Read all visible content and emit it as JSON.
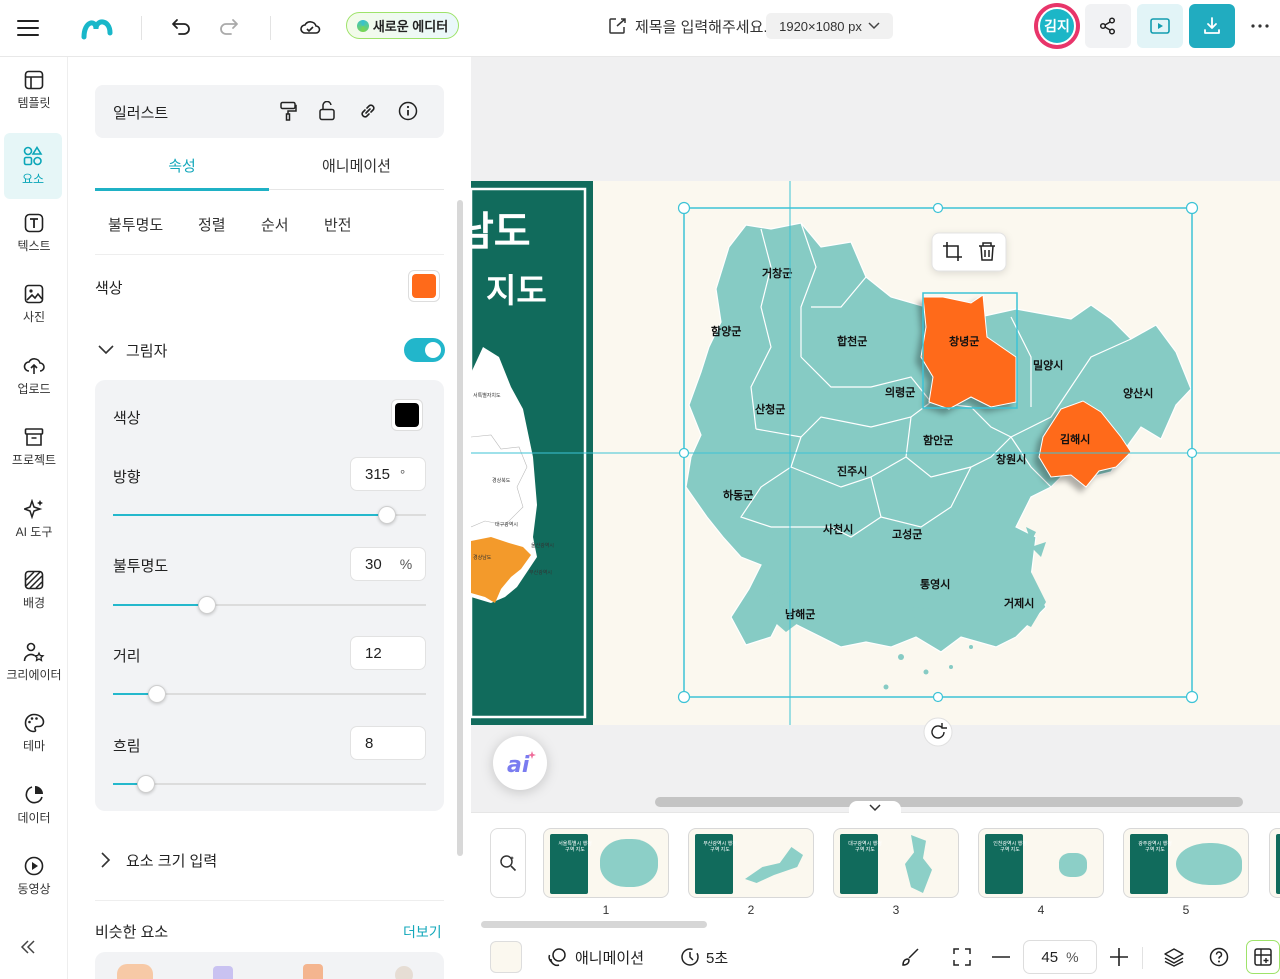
{
  "header": {
    "new_editor_label": "새로운 에디터",
    "doc_title_placeholder": "제목을 입력해주세요.",
    "size_label": "1920×1080 px",
    "avatar_name": "김지"
  },
  "rail": [
    {
      "label": "템플릿"
    },
    {
      "label": "요소"
    },
    {
      "label": "텍스트"
    },
    {
      "label": "사진"
    },
    {
      "label": "업로드"
    },
    {
      "label": "프로젝트"
    },
    {
      "label": "AI 도구"
    },
    {
      "label": "배경"
    },
    {
      "label": "크리에이터"
    },
    {
      "label": "테마"
    },
    {
      "label": "데이터"
    },
    {
      "label": "동영상"
    }
  ],
  "panel": {
    "element_type": "일러스트",
    "tabs": {
      "properties": "속성",
      "animation": "애니메이션"
    },
    "subtabs": [
      "불투명도",
      "정렬",
      "순서",
      "반전"
    ],
    "color_label": "색상",
    "fill_color": "#FF6A1A",
    "shadow": {
      "label": "그림자",
      "enabled": true,
      "color_label": "색상",
      "color": "#000000",
      "direction_label": "방향",
      "direction": 315,
      "direction_unit": "°",
      "direction_max": 360,
      "opacity_label": "불투명도",
      "opacity": 30,
      "opacity_unit": "%",
      "distance_label": "거리",
      "distance": 12,
      "distance_max": 100,
      "blur_label": "흐림",
      "blur": 8,
      "blur_max": 100
    },
    "size_input_label": "요소 크기 입력",
    "similar_label": "비슷한 요소",
    "more_label": "더보기"
  },
  "canvas": {
    "title_line1": "남도",
    "title_line2": "지도",
    "colors": {
      "green": "#116B5C",
      "map": "#86CBC4",
      "highlight": "#FF6A1A",
      "selection": "#3CC3D6",
      "page_bg": "#FBF8EF"
    },
    "regions": [
      "거창군",
      "함양군",
      "합천군",
      "창녕군",
      "밀양시",
      "양산시",
      "산청군",
      "의령군",
      "함안군",
      "김해시",
      "창원시",
      "진주시",
      "하동군",
      "사천시",
      "고성군",
      "통영시",
      "거제시",
      "남해군"
    ],
    "inset_labels": [
      "경상북도",
      "대구광역시",
      "울산광역시",
      "경상남도",
      "부산광역시"
    ]
  },
  "pages": [
    {
      "num": "1",
      "t": "서울특별시 행정구역 지도"
    },
    {
      "num": "2",
      "t": "부산광역시 행정구역 지도"
    },
    {
      "num": "3",
      "t": "대구광역시 행정구역 지도"
    },
    {
      "num": "4",
      "t": "인천광역시 행정구역 지도"
    },
    {
      "num": "5",
      "t": "광주광역시 행정구역 지도"
    }
  ],
  "footer": {
    "animation_label": "애니메이션",
    "duration_label": "5초",
    "zoom_value": "45",
    "zoom_unit": "%"
  }
}
